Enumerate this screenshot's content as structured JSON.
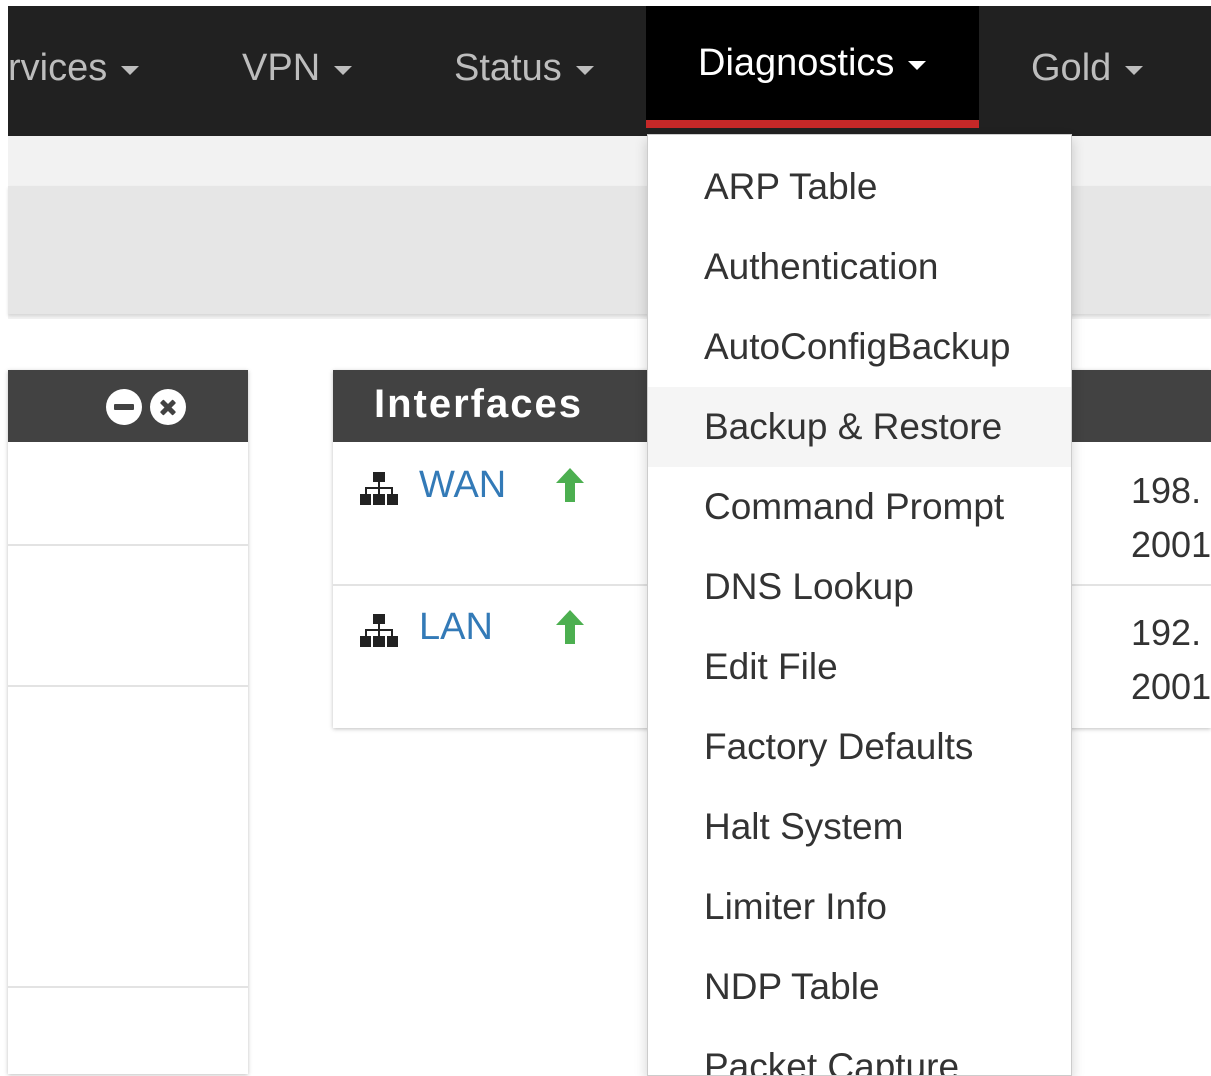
{
  "navbar": {
    "items": [
      {
        "label": "rvices"
      },
      {
        "label": "VPN"
      },
      {
        "label": "Status"
      },
      {
        "label": "Diagnostics",
        "active": true
      },
      {
        "label": "Gold"
      }
    ],
    "active_color": "#000000",
    "active_underline_color": "#c62828"
  },
  "dropdown": {
    "items": [
      "ARP Table",
      "Authentication",
      "AutoConfigBackup",
      "Backup & Restore",
      "Command Prompt",
      "DNS Lookup",
      "Edit File",
      "Factory Defaults",
      "Halt System",
      "Limiter Info",
      "NDP Table",
      "Packet Capture"
    ],
    "hovered": "Backup & Restore"
  },
  "interfaces_widget": {
    "title": "Interfaces",
    "rows": [
      {
        "name": "WAN",
        "status_icon": "arrow-up-icon",
        "status_color": "#4caf50",
        "ip_line1": "198.",
        "ip_line2": "2001"
      },
      {
        "name": "LAN",
        "status_icon": "arrow-up-icon",
        "status_color": "#4caf50",
        "ip_line1": "192.",
        "ip_line2": "2001"
      }
    ]
  },
  "left_widget": {
    "buttons": [
      "minimize-icon",
      "close-icon"
    ]
  }
}
